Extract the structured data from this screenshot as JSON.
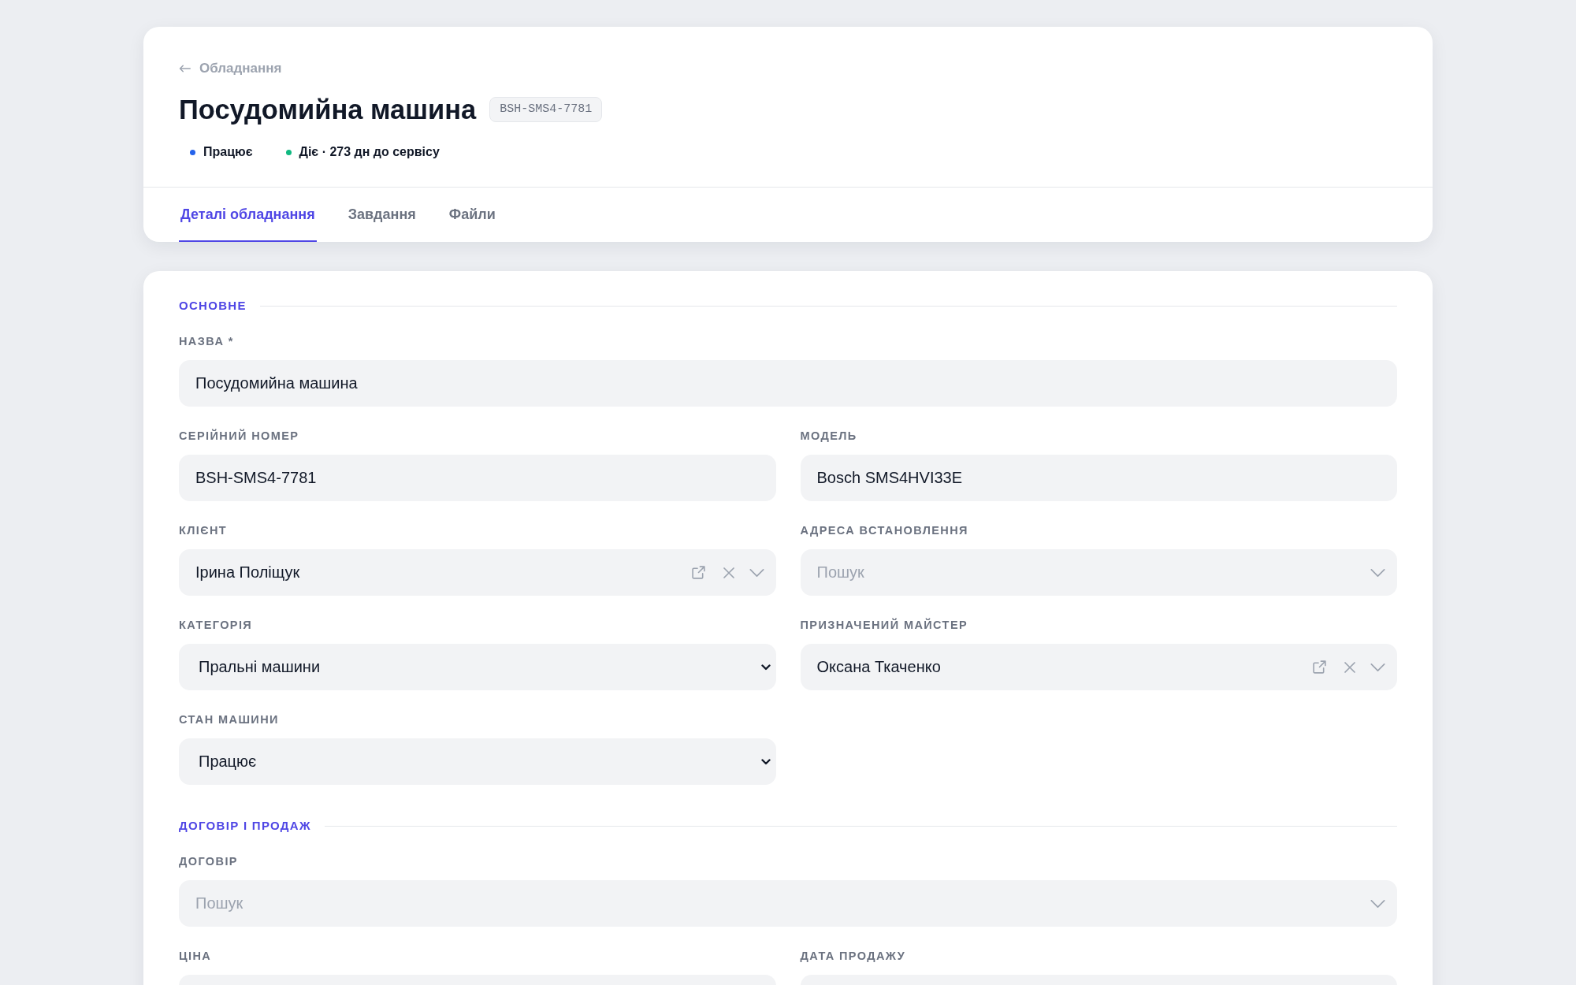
{
  "back_link": {
    "label": "Обладнання"
  },
  "title": "Посудомийна машина",
  "code": "BSH-SMS4-7781",
  "statuses": [
    {
      "label": "Працює",
      "color": "#2563eb"
    },
    {
      "label": "Діє · 273 дн до сервісу",
      "color": "#10b981"
    }
  ],
  "tabs": [
    {
      "label": "Деталі обладнання",
      "selected": true
    },
    {
      "label": "Завдання",
      "selected": false
    },
    {
      "label": "Файли",
      "selected": false
    }
  ],
  "sections": [
    {
      "title": "ОСНОВНЕ",
      "fields": [
        {
          "label": "НАЗВА *",
          "kind": "text",
          "wide": true,
          "value": "Посудомийна машина"
        },
        {
          "label": "СЕРІЙНИЙ НОМЕР",
          "kind": "text",
          "wide": false,
          "value": "BSH-SMS4-7781"
        },
        {
          "label": "МОДЕЛЬ",
          "kind": "text",
          "wide": false,
          "value": "Bosch SMS4HVI33E"
        },
        {
          "label": "КЛІЄНТ",
          "kind": "lookup",
          "wide": false,
          "value": "Ірина Поліщук"
        },
        {
          "label": "АДРЕСА ВСТАНОВЛЕННЯ",
          "kind": "lookup",
          "wide": false,
          "placeholder": "Пошук"
        },
        {
          "label": "КАТЕГОРІЯ",
          "kind": "select",
          "wide": false,
          "value": "Пральні машини"
        },
        {
          "label": "ПРИЗНАЧЕНИЙ МАЙСТЕР",
          "kind": "lookup",
          "wide": false,
          "value": "Оксана Ткаченко"
        },
        {
          "label": "СТАН МАШИНИ",
          "kind": "select",
          "wide": false,
          "value": "Працює"
        }
      ]
    },
    {
      "title": "ДОГОВІР І ПРОДАЖ",
      "fields": [
        {
          "label": "ДОГОВІР",
          "kind": "lookup",
          "wide": true,
          "placeholder": "Пошук"
        },
        {
          "label": "ЦІНА",
          "kind": "text",
          "wide": false
        },
        {
          "label": "ДАТА ПРОДАЖУ",
          "kind": "text",
          "wide": false
        }
      ]
    }
  ]
}
